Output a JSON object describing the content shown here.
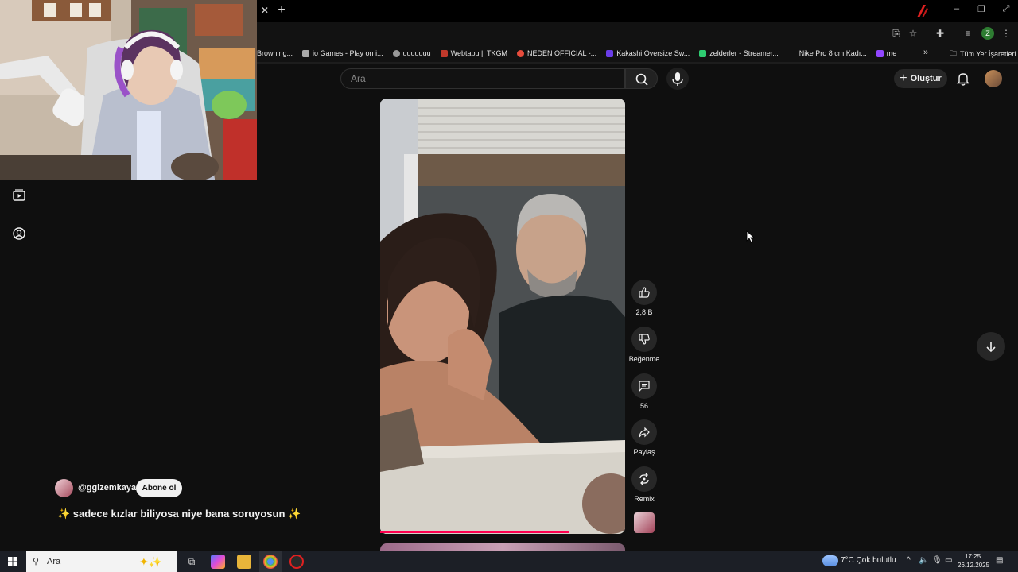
{
  "browser": {
    "bookmarks": [
      {
        "label": "Browning...",
        "color": "#888888"
      },
      {
        "label": "io Games - Play on i...",
        "color": "#aaaaaa"
      },
      {
        "label": "uuuuuuu",
        "color": "#999999"
      },
      {
        "label": "Webtapu || TKGM",
        "color": "#c0392b"
      },
      {
        "label": "NEDEN OFFICIAL -...",
        "color": "#e74c3c"
      },
      {
        "label": "Kakashi Oversize Sw...",
        "color": "#6a3de8"
      },
      {
        "label": "zelderler - Streamer...",
        "color": "#2ecc71"
      },
      {
        "label": "Nike Pro 8 cm Kadı...",
        "color": "#111111"
      },
      {
        "label": "me",
        "color": "#9146ff"
      }
    ],
    "all_bookmarks_label": "Tüm Yer İşaretleri",
    "profile_initial": "Z"
  },
  "youtube": {
    "search_placeholder": "Ara",
    "create_label": "Oluştur",
    "actions": {
      "like_count": "2,8 B",
      "dislike_label": "Beğenme",
      "comment_count": "56",
      "share_label": "Paylaş",
      "remix_label": "Remix"
    },
    "channel": {
      "handle": "@ggizemkaya",
      "subscribe_label": "Abone ol"
    },
    "caption": "✨ sadece kızlar biliyosa niye bana soruyosun ✨",
    "progress_fraction": 0.77
  },
  "taskbar": {
    "search_placeholder": "Ara",
    "weather": "7°C  Çok bulutlu",
    "time": "17:25",
    "date": "26.12.2025"
  },
  "colors": {
    "accent": "#ff0050",
    "background": "#0f0f0f",
    "button_bg": "#272727"
  }
}
